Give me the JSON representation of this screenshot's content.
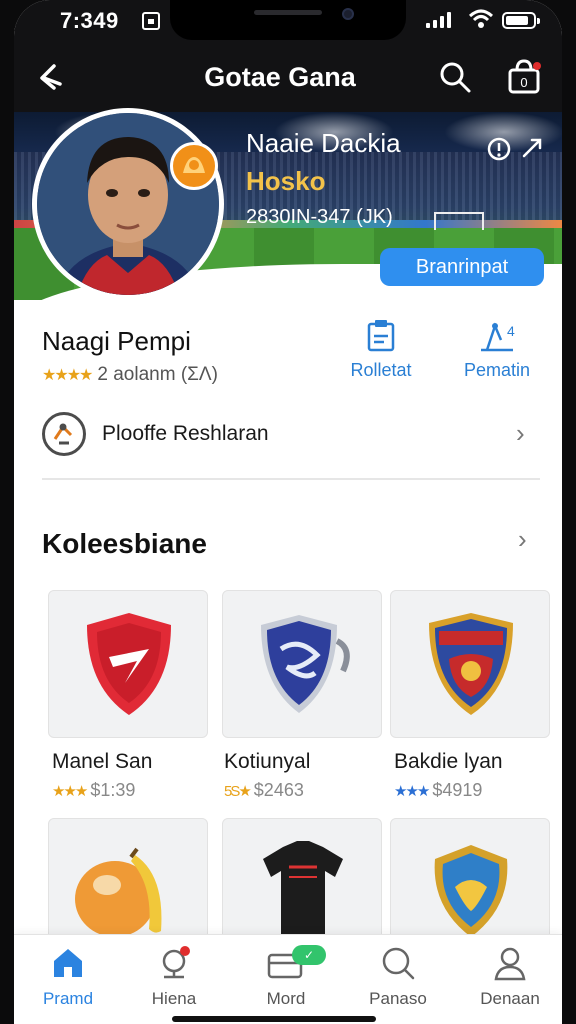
{
  "status_bar": {
    "time": "7:349"
  },
  "header": {
    "title": "Gotae Gana",
    "back_icon": "back-arrow-icon",
    "search_icon": "search-icon",
    "bag_icon": "shopping-bag-icon",
    "bag_count": "0"
  },
  "hero": {
    "name": "Naaie Dackia",
    "subtitle": "Hosko",
    "meta": "2830IN-347 (JK)",
    "button_label": "Branrinpat",
    "accent": "#2f8fef",
    "subtitle_color": "#f3c24a"
  },
  "profile": {
    "name": "Naagi Pempi",
    "stars": "★★★★",
    "rating_text": "2 aolanm (ΣΛ)",
    "actions": [
      {
        "label": "Rolletat",
        "icon": "certificate-icon"
      },
      {
        "label": "Pematin",
        "icon": "stats-icon"
      }
    ]
  },
  "row": {
    "label": "Plooffe Reshlaran",
    "icon": "whistle-badge-icon"
  },
  "collection": {
    "title": "Koleesbiane",
    "items": [
      {
        "name": "Manel San",
        "stars": "★★★",
        "price": "$1:39",
        "icon": "red-shield-icon",
        "star_color": "#e8a21a"
      },
      {
        "name": "Kotiunyal",
        "stars": "5S★",
        "price": "$2463",
        "icon": "blue-shield-icon",
        "star_color": "#e8a21a"
      },
      {
        "name": "Bakdie lyan",
        "stars": "★★★",
        "price": "$4919",
        "icon": "crest-icon",
        "star_color": "#2b6fd4"
      },
      {
        "name": "",
        "stars": "",
        "price": "",
        "icon": "orange-fruit-icon",
        "star_color": "#e8a21a"
      },
      {
        "name": "",
        "stars": "",
        "price": "",
        "icon": "jersey-icon",
        "star_color": "#e8a21a"
      },
      {
        "name": "",
        "stars": "",
        "price": "",
        "icon": "gold-crest-icon",
        "star_color": "#e8a21a"
      }
    ]
  },
  "bottom_nav": {
    "items": [
      {
        "label": "Pramd",
        "icon": "home-icon",
        "active": true
      },
      {
        "label": "Hiena",
        "icon": "radar-icon",
        "active": false
      },
      {
        "label": "Mord",
        "icon": "card-icon",
        "active": false,
        "pill": "✓"
      },
      {
        "label": "Panaso",
        "icon": "search-icon",
        "active": false
      },
      {
        "label": "Denaan",
        "icon": "user-icon",
        "active": false
      }
    ],
    "active_color": "#2b83e0"
  }
}
